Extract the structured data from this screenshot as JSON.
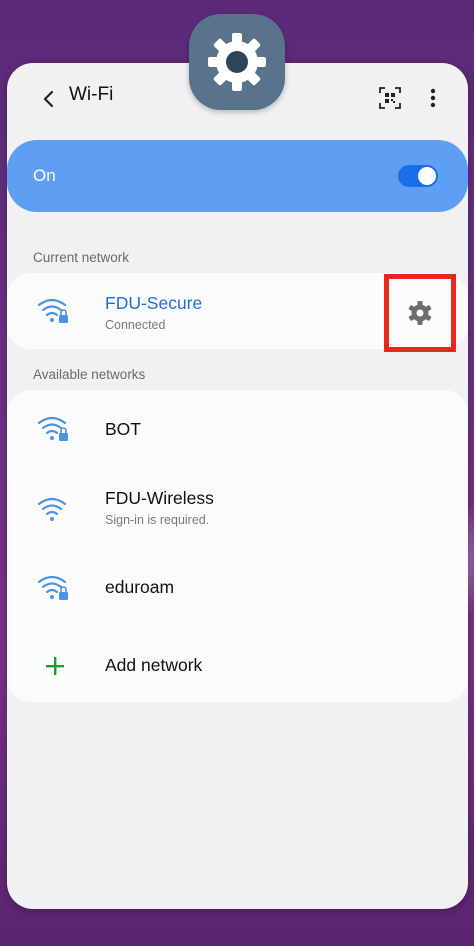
{
  "header": {
    "title": "Wi-Fi"
  },
  "toggle": {
    "label": "On",
    "state": "on"
  },
  "current_section": {
    "label": "Current network",
    "network": {
      "name": "FDU-Secure",
      "status": "Connected",
      "secured": true
    }
  },
  "available_section": {
    "label": "Available networks",
    "networks": [
      {
        "name": "BOT",
        "subtitle": "",
        "secured": true
      },
      {
        "name": "FDU-Wireless",
        "subtitle": "Sign-in is required.",
        "secured": false
      },
      {
        "name": "eduroam",
        "subtitle": "",
        "secured": true
      }
    ],
    "add_network_label": "Add network"
  },
  "colors": {
    "accent_blue": "#5e9ef3",
    "switch_blue": "#1a6fe8",
    "connected_text": "#1e6fd6",
    "highlight_red": "#e8281b",
    "add_green": "#1a9e3a",
    "app_icon_bg": "#58738b"
  },
  "icons": {
    "app": "settings-gear-icon",
    "back": "chevron-left-icon",
    "qr": "qr-scan-icon",
    "more": "more-vertical-icon",
    "wifi_lock": "wifi-lock-icon",
    "wifi": "wifi-icon",
    "network_settings": "gear-icon",
    "add": "plus-icon"
  }
}
